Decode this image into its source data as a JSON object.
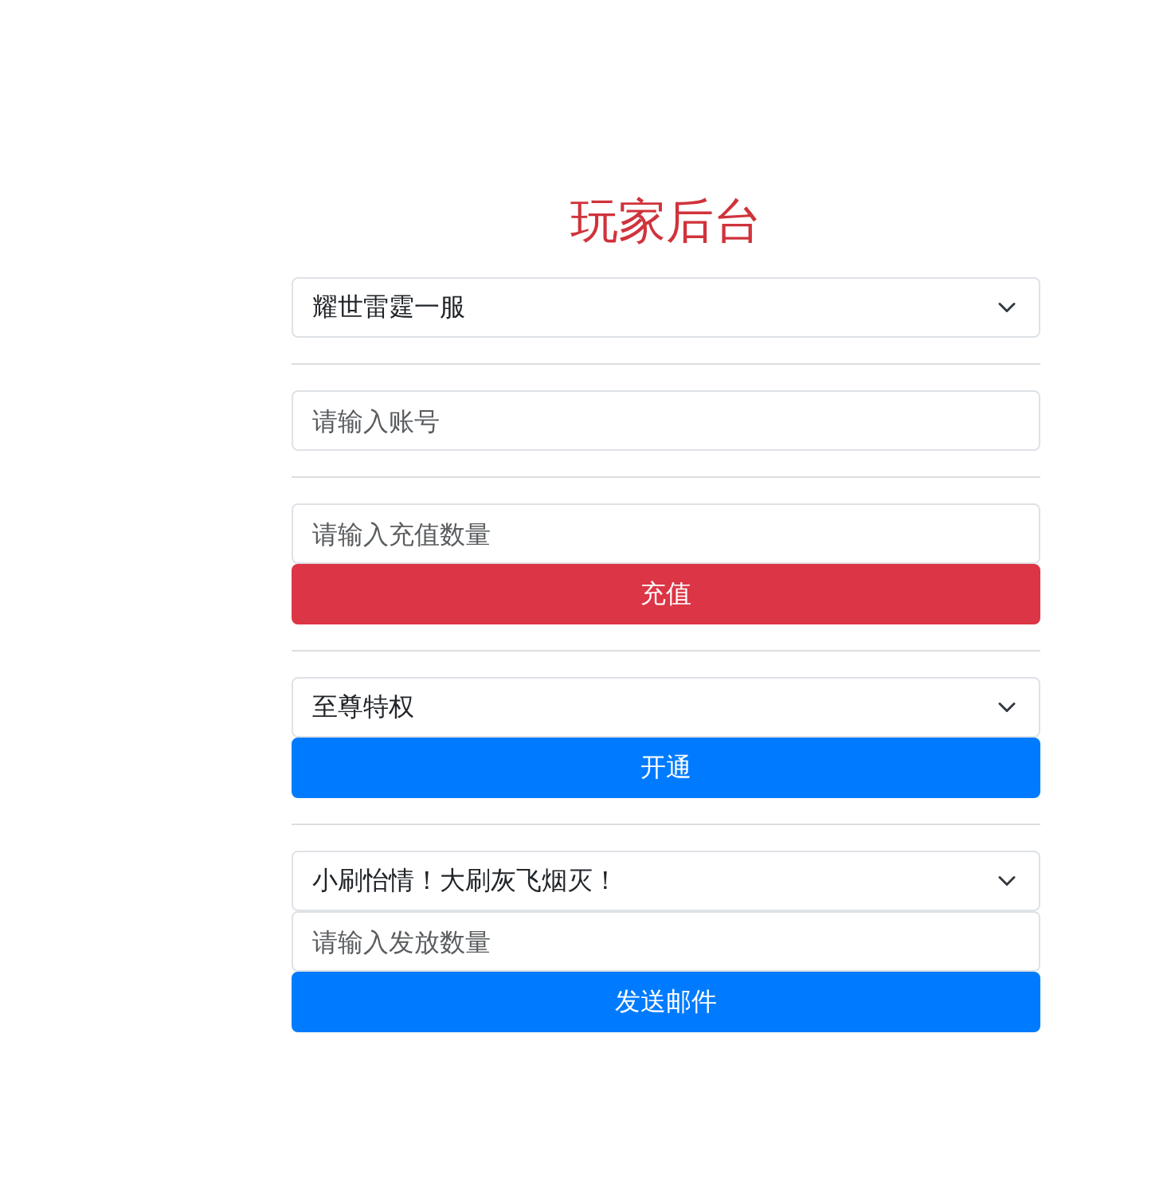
{
  "title": "玩家后台",
  "sections": [
    {
      "fields": [
        {
          "kind": "select",
          "value": "耀世雷霆一服"
        }
      ]
    },
    {
      "fields": [
        {
          "kind": "input",
          "placeholder": "请输入账号"
        }
      ]
    },
    {
      "fields": [
        {
          "kind": "input",
          "placeholder": "请输入充值数量"
        },
        {
          "kind": "button",
          "color": "#dc3545",
          "label": "充值"
        }
      ]
    },
    {
      "fields": [
        {
          "kind": "select",
          "value": "至尊特权"
        },
        {
          "kind": "button",
          "color": "#007bff",
          "label": "开通"
        }
      ]
    },
    {
      "fields": [
        {
          "kind": "select",
          "value": "小刷怡情！大刷灰飞烟灭！"
        },
        {
          "kind": "input",
          "placeholder": "请输入发放数量"
        },
        {
          "kind": "button",
          "color": "#007bff",
          "label": "发送邮件"
        }
      ]
    }
  ]
}
